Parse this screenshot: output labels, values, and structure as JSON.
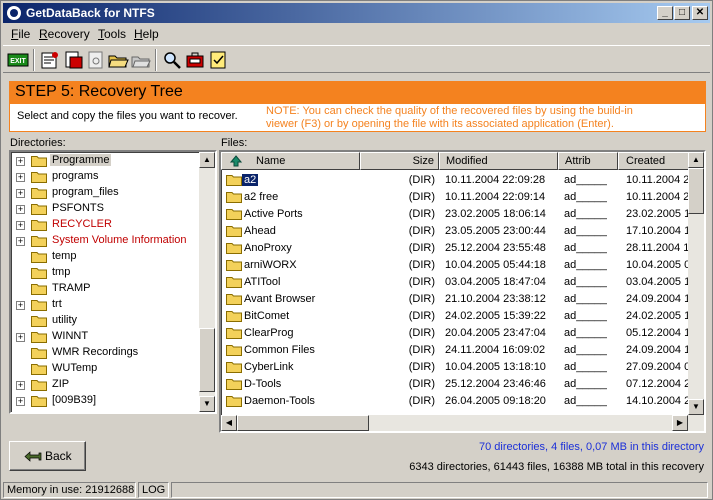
{
  "window": {
    "title": "GetDataBack for NTFS",
    "min": "_",
    "max": "□",
    "close": "✕"
  },
  "menu": [
    "File",
    "Recovery",
    "Tools",
    "Help"
  ],
  "toolbar": {
    "exit_label": "EXIT",
    "buttons": [
      "exit-icon",
      "properties-icon",
      "cut-icon",
      "document-icon",
      "open-folder-icon",
      "save-icon",
      "search-icon",
      "briefcase-icon",
      "notepad-icon"
    ]
  },
  "step": {
    "title": "STEP 5: Recovery Tree",
    "instruction": "Select and copy the files you want to recover.",
    "note": "NOTE: You can check the quality of the recovered files by using the build-in viewer (F3) or by opening the file with its associated application (Enter)."
  },
  "directories": {
    "label": "Directories:",
    "items": [
      {
        "name": "Programme",
        "expandable": true,
        "selected": true,
        "red": false
      },
      {
        "name": "programs",
        "expandable": true,
        "selected": false,
        "red": false
      },
      {
        "name": "program_files",
        "expandable": true,
        "selected": false,
        "red": false
      },
      {
        "name": "PSFONTS",
        "expandable": true,
        "selected": false,
        "red": false
      },
      {
        "name": "RECYCLER",
        "expandable": true,
        "selected": false,
        "red": true
      },
      {
        "name": "System Volume Information",
        "expandable": true,
        "selected": false,
        "red": true
      },
      {
        "name": "temp",
        "expandable": false,
        "selected": false,
        "red": false
      },
      {
        "name": "tmp",
        "expandable": false,
        "selected": false,
        "red": false
      },
      {
        "name": "TRAMP",
        "expandable": false,
        "selected": false,
        "red": false
      },
      {
        "name": "trt",
        "expandable": true,
        "selected": false,
        "red": false
      },
      {
        "name": "utility",
        "expandable": false,
        "selected": false,
        "red": false
      },
      {
        "name": "WINNT",
        "expandable": true,
        "selected": false,
        "red": false
      },
      {
        "name": "WMR Recordings",
        "expandable": false,
        "selected": false,
        "red": false
      },
      {
        "name": "WUTemp",
        "expandable": false,
        "selected": false,
        "red": false
      },
      {
        "name": "ZIP",
        "expandable": true,
        "selected": false,
        "red": false
      },
      {
        "name": "[009B39]",
        "expandable": true,
        "selected": false,
        "red": false
      }
    ]
  },
  "files": {
    "label": "Files:",
    "columns": {
      "name": "Name",
      "size": "Size",
      "modified": "Modified",
      "attrib": "Attrib",
      "created": "Created"
    },
    "rows": [
      {
        "name": "a2",
        "size": "(DIR)",
        "modified": "10.11.2004 22:09:28",
        "attrib": "ad_____",
        "created": "10.11.2004 2",
        "selected": true
      },
      {
        "name": "a2 free",
        "size": "(DIR)",
        "modified": "10.11.2004 22:09:14",
        "attrib": "ad_____",
        "created": "10.11.2004 2",
        "selected": false
      },
      {
        "name": "Active Ports",
        "size": "(DIR)",
        "modified": "23.02.2005 18:06:14",
        "attrib": "ad_____",
        "created": "23.02.2005 1",
        "selected": false
      },
      {
        "name": "Ahead",
        "size": "(DIR)",
        "modified": "23.05.2005 23:00:44",
        "attrib": "ad_____",
        "created": "17.10.2004 1",
        "selected": false
      },
      {
        "name": "AnoProxy",
        "size": "(DIR)",
        "modified": "25.12.2004 23:55:48",
        "attrib": "ad_____",
        "created": "28.11.2004 1",
        "selected": false
      },
      {
        "name": "arniWORX",
        "size": "(DIR)",
        "modified": "10.04.2005 05:44:18",
        "attrib": "ad_____",
        "created": "10.04.2005 0",
        "selected": false
      },
      {
        "name": "ATITool",
        "size": "(DIR)",
        "modified": "03.04.2005 18:47:04",
        "attrib": "ad_____",
        "created": "03.04.2005 1",
        "selected": false
      },
      {
        "name": "Avant Browser",
        "size": "(DIR)",
        "modified": "21.10.2004 23:38:12",
        "attrib": "ad_____",
        "created": "24.09.2004 1",
        "selected": false
      },
      {
        "name": "BitComet",
        "size": "(DIR)",
        "modified": "24.02.2005 15:39:22",
        "attrib": "ad_____",
        "created": "24.02.2005 1",
        "selected": false
      },
      {
        "name": "ClearProg",
        "size": "(DIR)",
        "modified": "20.04.2005 23:47:04",
        "attrib": "ad_____",
        "created": "05.12.2004 1",
        "selected": false
      },
      {
        "name": "Common Files",
        "size": "(DIR)",
        "modified": "24.11.2004 16:09:02",
        "attrib": "ad_____",
        "created": "24.09.2004 1",
        "selected": false
      },
      {
        "name": "CyberLink",
        "size": "(DIR)",
        "modified": "10.04.2005 13:18:10",
        "attrib": "ad_____",
        "created": "27.09.2004 0",
        "selected": false
      },
      {
        "name": "D-Tools",
        "size": "(DIR)",
        "modified": "25.12.2004 23:46:46",
        "attrib": "ad_____",
        "created": "07.12.2004 2",
        "selected": false
      },
      {
        "name": "Daemon-Tools",
        "size": "(DIR)",
        "modified": "26.04.2005 09:18:20",
        "attrib": "ad_____",
        "created": "14.10.2004 2",
        "selected": false
      }
    ]
  },
  "back_button": "Back",
  "status": {
    "dir_summary": "70 directories, 4 files, 0,07 MB in this directory",
    "total_summary": "6343 directories, 61443 files, 16388 MB total in this recovery",
    "memory": "Memory in use: 21912688",
    "log": "LOG"
  }
}
